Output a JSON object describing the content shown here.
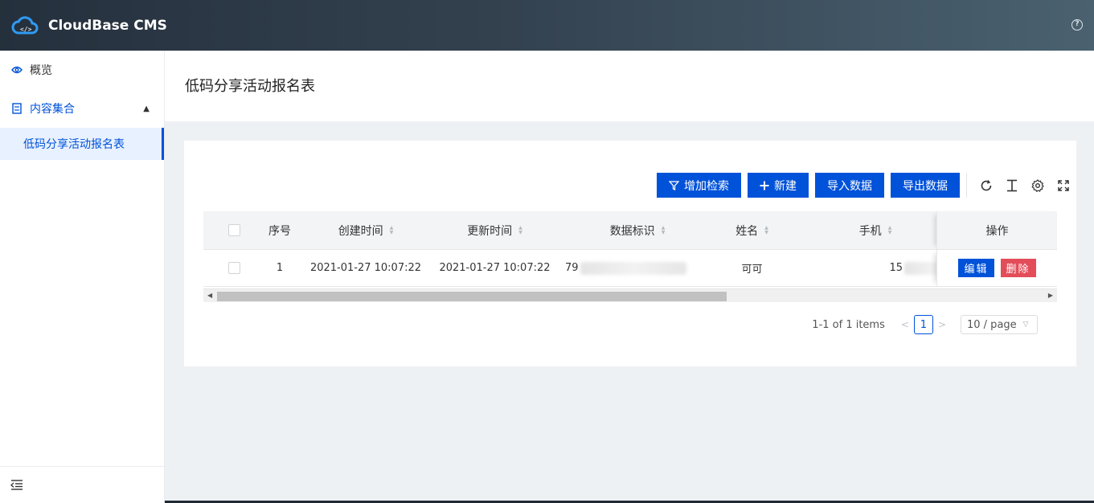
{
  "header": {
    "app_title": "CloudBase CMS",
    "logo_icon": "cloud-code-icon",
    "help_icon": "question-circle-icon"
  },
  "sidebar": {
    "items": [
      {
        "label": "概览",
        "icon": "eye-icon"
      },
      {
        "label": "内容集合",
        "icon": "collection-icon",
        "expanded": true
      }
    ],
    "sub_items": [
      {
        "label": "低码分享活动报名表",
        "active": true
      }
    ],
    "footer_icon": "collapse-menu-icon"
  },
  "page": {
    "title": "低码分享活动报名表"
  },
  "toolbar": {
    "add_filter_label": "增加检索",
    "new_label": "新建",
    "import_label": "导入数据",
    "export_label": "导出数据",
    "tools": [
      "refresh-icon",
      "column-settings-icon",
      "gear-icon",
      "fullscreen-icon"
    ]
  },
  "table": {
    "columns": [
      "序号",
      "创建时间",
      "更新时间",
      "数据标识",
      "姓名",
      "手机",
      "操作"
    ],
    "rows": [
      {
        "index": "1",
        "created": "2021-01-27 10:07:22",
        "updated": "2021-01-27 10:07:22",
        "id_prefix": "79",
        "name": "可可",
        "phone_prefix": "15"
      }
    ],
    "edit_label": "编辑",
    "delete_label": "删除"
  },
  "pagination": {
    "total_text": "1-1 of 1 items",
    "current_page": "1",
    "page_size": "10 / page"
  },
  "colors": {
    "primary": "#0052d9",
    "danger": "#e34d59"
  }
}
